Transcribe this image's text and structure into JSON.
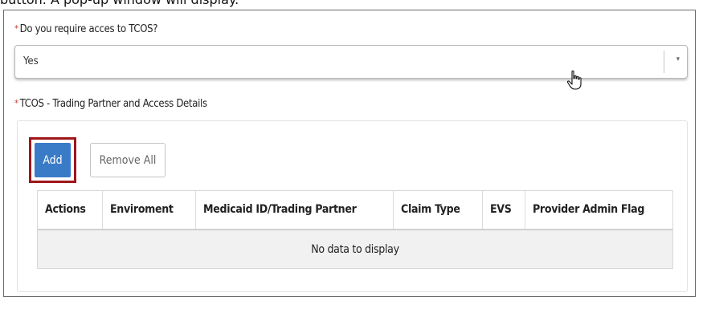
{
  "caption": "button. A pop-up window will display.",
  "form": {
    "tcos_question": {
      "required_mark": "*",
      "label": "Do you require acces to TCOS?",
      "selected_value": "Yes",
      "arrow": "▾"
    },
    "details": {
      "required_mark": "*",
      "label": "TCOS - Trading Partner and Access Details",
      "add_label": "Add",
      "remove_all_label": "Remove All",
      "highlight_color": "#a0161b",
      "table": {
        "columns": [
          "Actions",
          "Enviroment",
          "Medicaid ID/Trading Partner",
          "Claim Type",
          "EVS",
          "Provider Admin Flag"
        ],
        "empty_message": "No data to display"
      }
    }
  },
  "colors": {
    "primary_button": "#3a7bc8",
    "empty_row_bg": "#f1f1f1"
  }
}
